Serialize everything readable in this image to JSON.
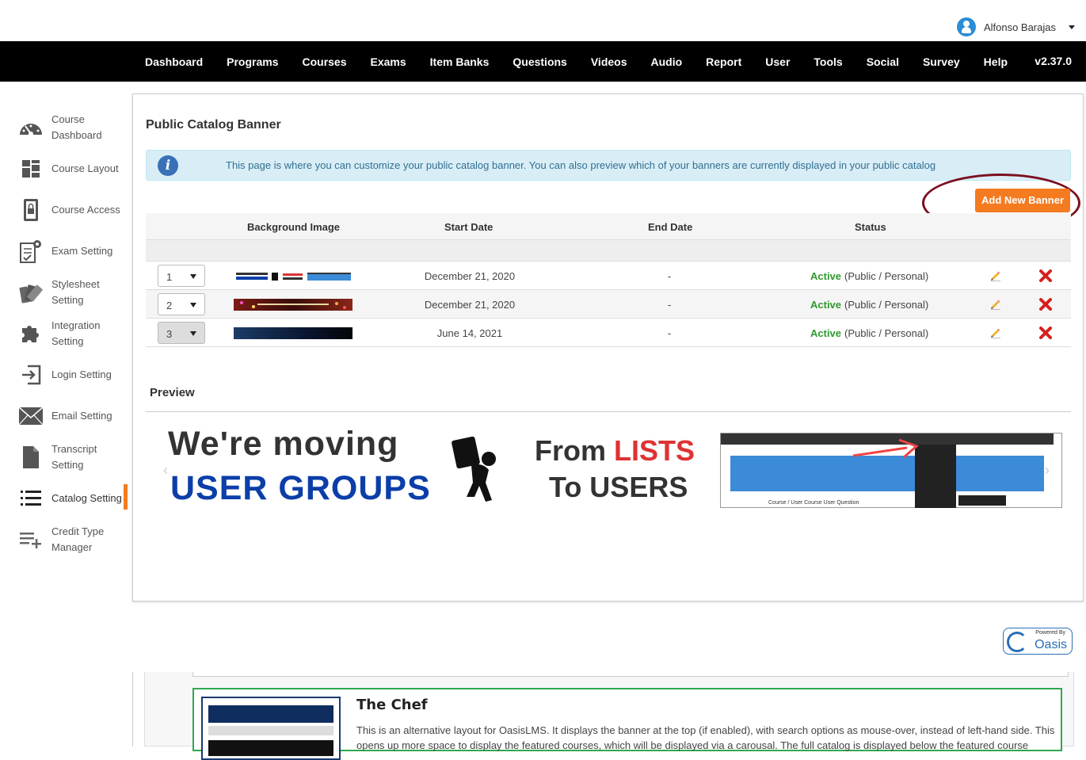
{
  "user": {
    "name": "Alfonso Barajas"
  },
  "nav": {
    "items": [
      "Dashboard",
      "Programs",
      "Courses",
      "Exams",
      "Item Banks",
      "Questions",
      "Videos",
      "Audio",
      "Report",
      "User",
      "Tools",
      "Social",
      "Survey",
      "Help"
    ],
    "version": "v2.37.0"
  },
  "sidebar": {
    "items": [
      {
        "label": "Course Dashboard",
        "icon": "gauge-icon"
      },
      {
        "label": "Course Layout",
        "icon": "layout-icon"
      },
      {
        "label": "Course Access",
        "icon": "lock-icon"
      },
      {
        "label": "Exam Setting",
        "icon": "exam-gear-icon"
      },
      {
        "label": "Stylesheet Setting",
        "icon": "swatches-icon"
      },
      {
        "label": "Integration Setting",
        "icon": "puzzle-icon"
      },
      {
        "label": "Login Setting",
        "icon": "login-icon"
      },
      {
        "label": "Email Setting",
        "icon": "envelope-icon"
      },
      {
        "label": "Transcript Setting",
        "icon": "document-icon"
      },
      {
        "label": "Catalog Setting",
        "icon": "list-icon",
        "active": true
      },
      {
        "label": "Credit Type Manager",
        "icon": "list-add-icon"
      }
    ]
  },
  "page": {
    "title": "Public Catalog Banner",
    "info": "This page is where you can customize your public catalog banner. You can also preview which of your banners are currently displayed in your public catalog",
    "add_button": "Add New Banner"
  },
  "table": {
    "headers": {
      "image": "Background Image",
      "start": "Start Date",
      "end": "End Date",
      "status": "Status"
    },
    "rows": [
      {
        "order": "1",
        "start": "December 21, 2020",
        "end": "-",
        "status": "Active",
        "visibility": "(Public / Personal)"
      },
      {
        "order": "2",
        "start": "December 21, 2020",
        "end": "-",
        "status": "Active",
        "visibility": "(Public / Personal)"
      },
      {
        "order": "3",
        "start": "June 14, 2021",
        "end": "-",
        "status": "Active",
        "visibility": "(Public / Personal)"
      }
    ]
  },
  "preview": {
    "title": "Preview",
    "banner": {
      "line1": "We're moving",
      "line2": "USER GROUPS",
      "from": "From ",
      "lists": "LISTS",
      "to": "To USERS",
      "screenshot_sub": "Course / User    Course    User    Question"
    }
  },
  "logo": {
    "powered": "Powered By",
    "name": "Oasis"
  },
  "card": {
    "title": "The Chef",
    "desc": "This is an alternative layout for OasisLMS. It displays the banner at the top (if enabled), with search options as mouse-over, instead of left-hand side. This opens up more space to display the featured courses, which will be displayed via a carousal. The full catalog is displayed below the featured course"
  },
  "colors": {
    "accent": "#f47b20",
    "active_status": "#2e9a2e",
    "nav_bg": "#000000",
    "info_bg": "#d9edf7",
    "highlight_ellipse": "#7b1020",
    "card_border": "#2fa84f"
  }
}
